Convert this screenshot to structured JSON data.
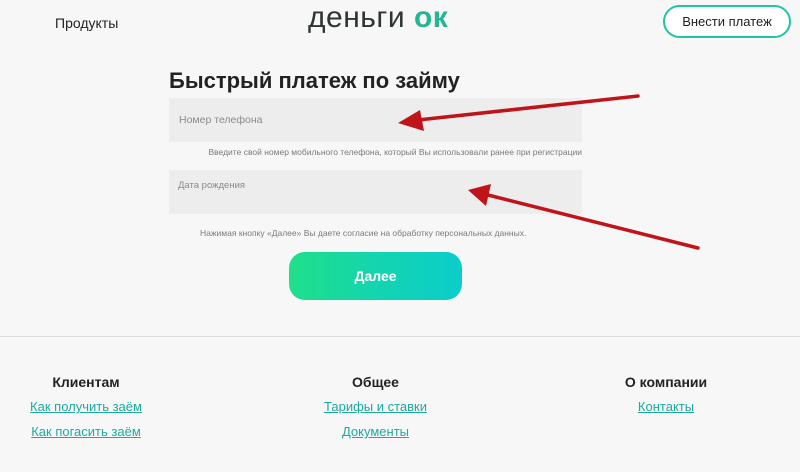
{
  "header": {
    "products_label": "Продукты",
    "logo_text": "деньги",
    "logo_ok": "ок",
    "pay_button_label": "Внести платеж"
  },
  "form": {
    "title": "Быстрый платеж по займу",
    "phone_placeholder": "Номер телефона",
    "phone_hint": "Введите свой номер мобильного телефона, который Вы использовали ранее при регистрации",
    "birth_placeholder": "Дата рождения",
    "consent_text": "Нажимая кнопку «Далее» Вы даете согласие на обработку персональных данных.",
    "next_button_label": "Далее"
  },
  "footer": {
    "clients": {
      "heading": "Клиентам",
      "links": [
        "Как получить заём",
        "Как погасить заём"
      ]
    },
    "general": {
      "heading": "Общее",
      "links": [
        "Тарифы и ставки",
        "Документы"
      ]
    },
    "company": {
      "heading": "О компании",
      "links": [
        "Контакты"
      ]
    }
  },
  "colors": {
    "accent": "#1ec4a4",
    "link": "#1ea9a0",
    "arrow": "#c0141b",
    "button_gradient_start": "#20df8a",
    "button_gradient_end": "#0ccdcb"
  }
}
